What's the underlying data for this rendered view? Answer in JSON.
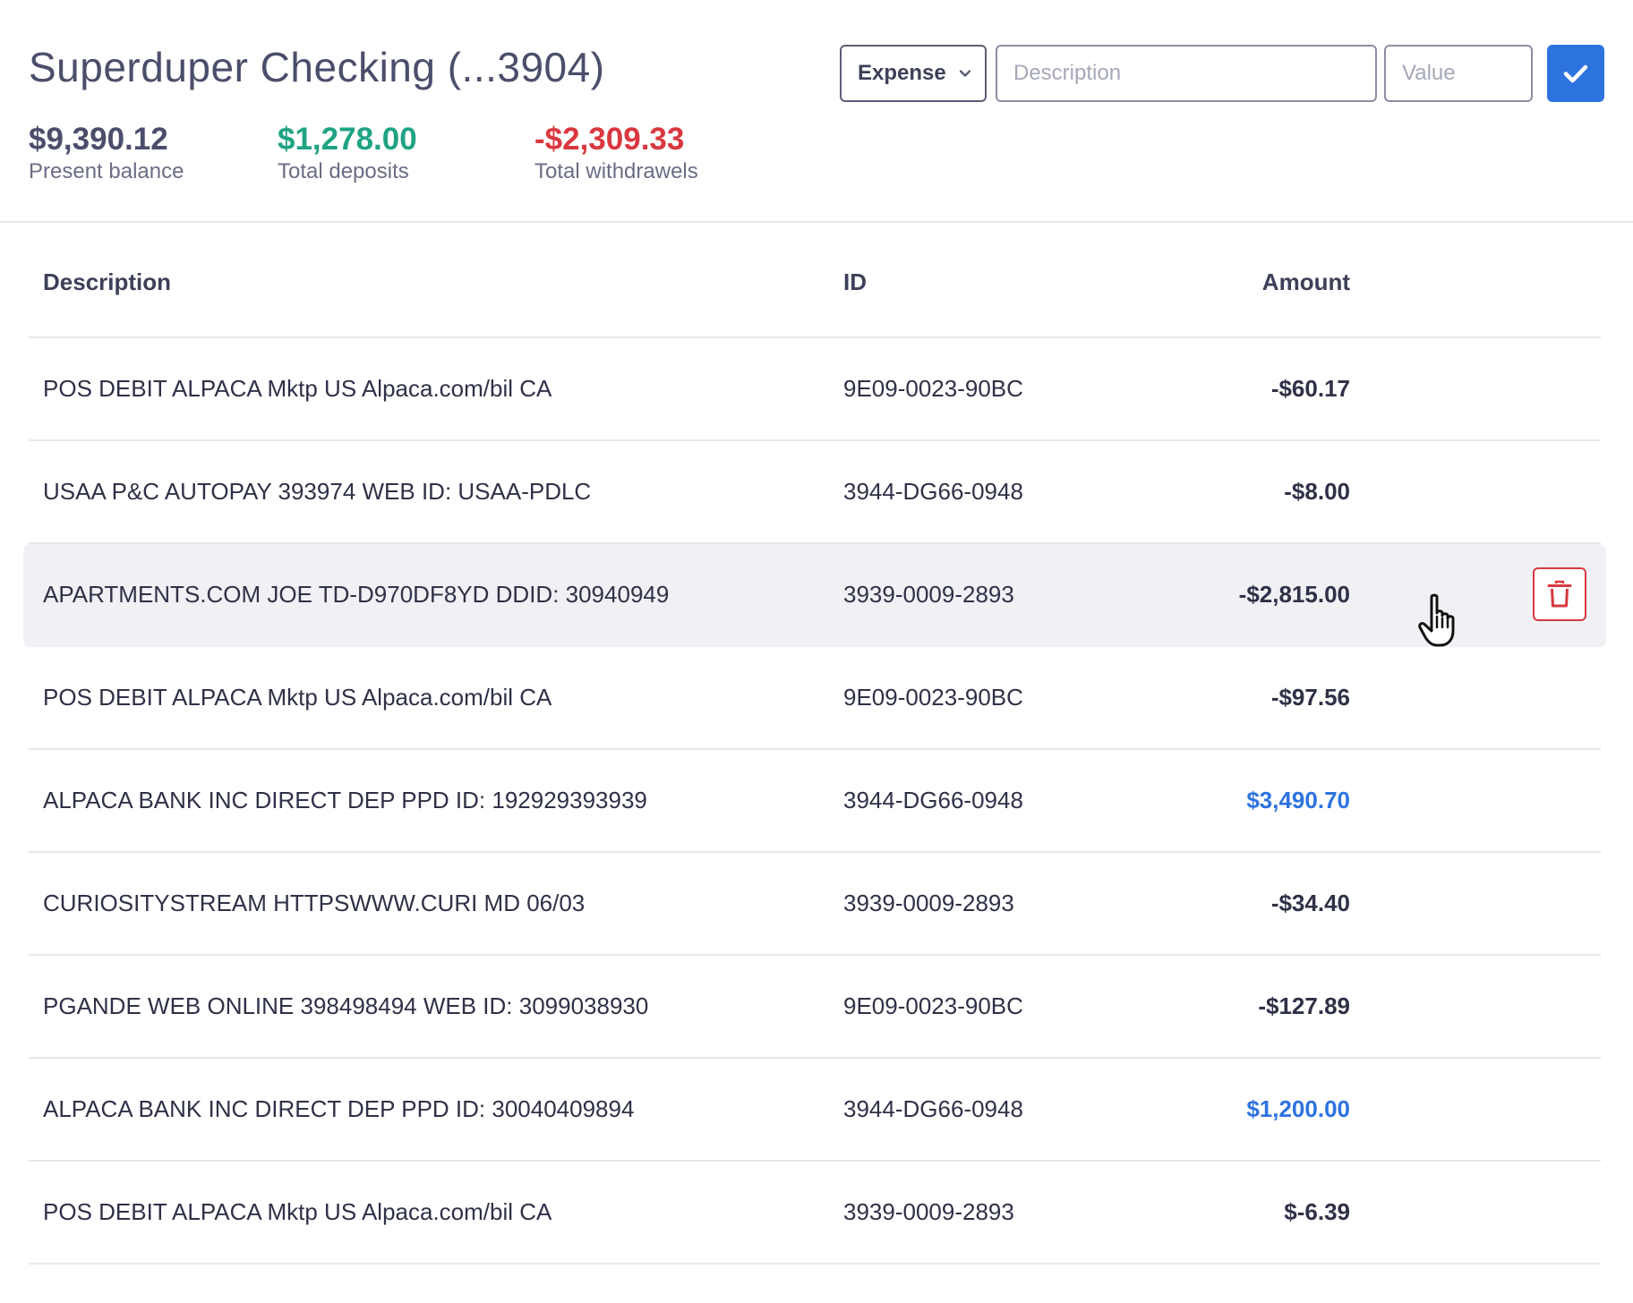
{
  "account": {
    "title": "Superduper Checking (...3904)"
  },
  "stats": {
    "balance": {
      "value": "$9,390.12",
      "label": "Present balance"
    },
    "deposits": {
      "value": "$1,278.00",
      "label": "Total deposits"
    },
    "withdrawals": {
      "value": "-$2,309.33",
      "label": "Total withdrawels"
    }
  },
  "form": {
    "type_selected": "Expense",
    "description_placeholder": "Description",
    "value_placeholder": "Value",
    "confirm_icon": "check-icon"
  },
  "colors": {
    "accent": "#2d73e0",
    "deposit": "#1fa383",
    "withdrawal": "#d9383f",
    "row_hover": "#f0f0f5"
  },
  "table": {
    "headers": {
      "description": "Description",
      "id": "ID",
      "amount": "Amount"
    },
    "rows": [
      {
        "description": "POS DEBIT ALPACA Mktp US Alpaca.com/bil CA",
        "id": "9E09-0023-90BC",
        "amount": "-$60.17",
        "type": "withdrawal"
      },
      {
        "description": "USAA P&C AUTOPAY 393974 WEB ID: USAA-PDLC",
        "id": "3944-DG66-0948",
        "amount": "-$8.00",
        "type": "withdrawal"
      },
      {
        "description": "APARTMENTS.COM JOE TD-D970DF8YD DDID: 30940949",
        "id": "3939-0009-2893",
        "amount": "-$2,815.00",
        "type": "withdrawal",
        "hovered": true
      },
      {
        "description": "POS DEBIT ALPACA Mktp US Alpaca.com/bil CA",
        "id": "9E09-0023-90BC",
        "amount": "-$97.56",
        "type": "withdrawal"
      },
      {
        "description": "ALPACA BANK INC DIRECT DEP PPD ID: 192929393939",
        "id": "3944-DG66-0948",
        "amount": "$3,490.70",
        "type": "deposit"
      },
      {
        "description": "CURIOSITYSTREAM HTTPSWWW.CURI MD 06/03",
        "id": "3939-0009-2893",
        "amount": "-$34.40",
        "type": "withdrawal"
      },
      {
        "description": "PGANDE WEB ONLINE 398498494 WEB ID: 3099038930",
        "id": "9E09-0023-90BC",
        "amount": "-$127.89",
        "type": "withdrawal"
      },
      {
        "description": "ALPACA BANK INC DIRECT DEP PPD ID: 30040409894",
        "id": "3944-DG66-0948",
        "amount": "$1,200.00",
        "type": "deposit"
      },
      {
        "description": "POS DEBIT ALPACA Mktp US Alpaca.com/bil CA",
        "id": "3939-0009-2893",
        "amount": "$-6.39",
        "type": "withdrawal"
      }
    ],
    "row_action_icon": "trash-icon"
  },
  "cursor_icon": "hand-pointer-icon"
}
